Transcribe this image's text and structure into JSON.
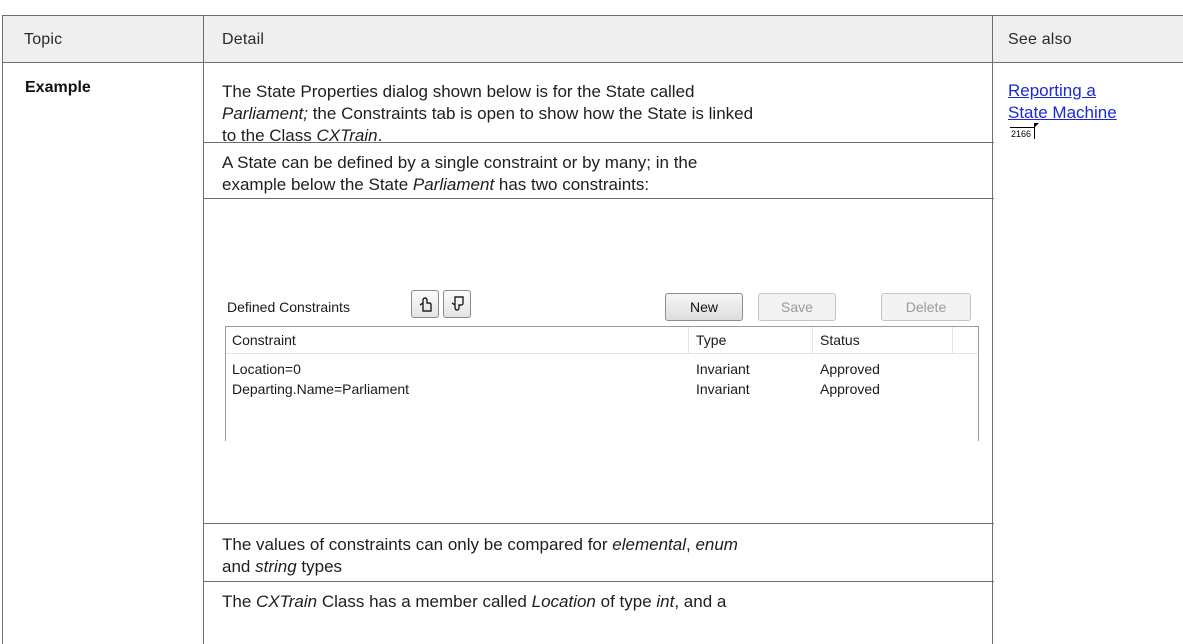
{
  "table": {
    "headers": {
      "topic": "Topic",
      "detail": "Detail",
      "see_also": "See also"
    },
    "row": {
      "topic": "Example",
      "see_also": {
        "link": "Reporting a State Machine",
        "line1": "Reporting a",
        "line2": "State Machine",
        "page": "2166"
      },
      "para1": {
        "a": "The State Properties dialog shown below is for the State called",
        "b_italic": "Parliament;",
        "c": " the Constraints tab is open to show how the State is linked",
        "d": "to the Class ",
        "e_italic": "CXTrain",
        "f": "."
      },
      "para2": {
        "a": "A State can be defined by a single constraint or by many; in the",
        "b": "example below the State ",
        "c_italic": "Parliament",
        "d": " has two constraints:"
      },
      "para3": {
        "a": "The values of constraints can only be compared for ",
        "b_italic": "elemental",
        "c": ", ",
        "d_italic": "enum",
        "e": "and ",
        "f_italic": "string",
        "g": " types"
      },
      "para4": {
        "a": "The ",
        "b_italic": "CXTrain",
        "c": " Class has a member called ",
        "d_italic": "Location",
        "e": " of type ",
        "f_italic": "int",
        "g": ", and a"
      }
    }
  },
  "constraints_panel": {
    "label": "Defined Constraints",
    "icons": [
      "hand-up-icon",
      "hand-down-icon"
    ],
    "buttons": {
      "new": "New",
      "save": "Save",
      "delete": "Delete"
    },
    "columns": [
      "Constraint",
      "Type",
      "Status"
    ],
    "rows": [
      {
        "constraint": "Location=0",
        "type": "Invariant",
        "status": "Approved"
      },
      {
        "constraint": "Departing.Name=Parliament",
        "type": "Invariant",
        "status": "Approved"
      }
    ]
  },
  "colors": {
    "link": "#1a29d6",
    "header_bg": "#efefef",
    "border": "#6e6e6e"
  }
}
